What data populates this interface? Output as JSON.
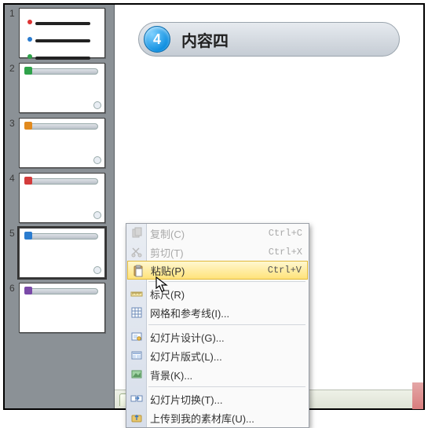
{
  "rail": {
    "slides": [
      {
        "num": "1",
        "variant": "list",
        "selected": false
      },
      {
        "num": "2",
        "variant": "title-green",
        "accent": "#2fa24a",
        "selected": false
      },
      {
        "num": "3",
        "variant": "title-orange",
        "accent": "#e18a1e",
        "selected": false
      },
      {
        "num": "4",
        "variant": "title-red",
        "accent": "#d33b3b",
        "selected": false
      },
      {
        "num": "5",
        "variant": "title-blue",
        "accent": "#2b7ccf",
        "selected": true
      },
      {
        "num": "6",
        "variant": "title-purple",
        "accent": "#7a4aa8",
        "selected": false
      }
    ]
  },
  "slide": {
    "badge_number": "4",
    "title": "内容四"
  },
  "context_menu": {
    "items": [
      {
        "id": "copy",
        "icon": "copy-icon",
        "label": "复制(C)",
        "shortcut": "Ctrl+C",
        "enabled": false
      },
      {
        "id": "cut",
        "icon": "cut-icon",
        "label": "剪切(T)",
        "shortcut": "Ctrl+X",
        "enabled": false
      },
      {
        "id": "paste",
        "icon": "paste-icon",
        "label": "粘贴(P)",
        "shortcut": "Ctrl+V",
        "enabled": true,
        "hover": true
      },
      {
        "sep": true
      },
      {
        "id": "ruler",
        "icon": "ruler-icon",
        "label": "标尺(R)",
        "shortcut": "",
        "enabled": true
      },
      {
        "id": "grid",
        "icon": "grid-icon",
        "label": "网格和参考线(I)...",
        "shortcut": "",
        "enabled": true
      },
      {
        "sep": true
      },
      {
        "id": "setup",
        "icon": "setup-icon",
        "label": "幻灯片设计(G)...",
        "shortcut": "",
        "enabled": true
      },
      {
        "id": "layout",
        "icon": "layout-icon",
        "label": "幻灯片版式(L)...",
        "shortcut": "",
        "enabled": true
      },
      {
        "id": "background",
        "icon": "background-icon",
        "label": "背景(K)...",
        "shortcut": "",
        "enabled": true
      },
      {
        "sep": true
      },
      {
        "id": "transition",
        "icon": "transition-icon",
        "label": "幻灯片切换(T)...",
        "shortcut": "",
        "enabled": true
      },
      {
        "id": "upload",
        "icon": "upload-icon",
        "label": "上传到我的素材库(U)...",
        "shortcut": "",
        "enabled": true
      }
    ]
  }
}
